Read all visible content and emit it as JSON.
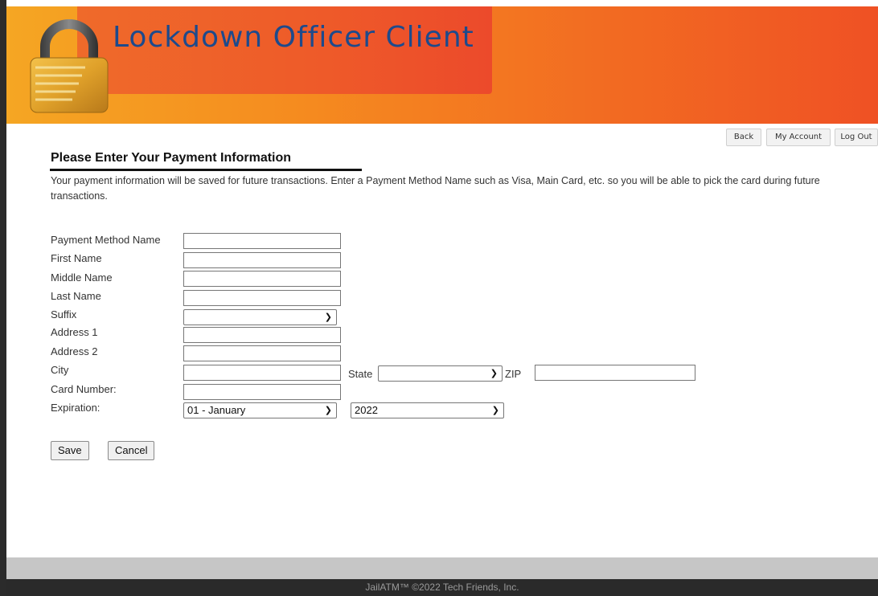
{
  "header": {
    "title": "Lockdown Officer Client",
    "logo_icon": "padlock-icon",
    "colors": {
      "banner_start": "#f5a623",
      "banner_end": "#ef5124",
      "title_color": "#1d4a8c"
    }
  },
  "nav": {
    "back": "Back",
    "my_account": "My Account",
    "log_out": "Log Out"
  },
  "page": {
    "title": "Please Enter Your Payment Information",
    "intro": "Your payment information will be saved for future transactions. Enter a Payment Method Name such as Visa, Main Card, etc. so you will be able to pick the card during future transactions."
  },
  "form": {
    "payment_method_name": {
      "label": "Payment Method Name",
      "value": ""
    },
    "first_name": {
      "label": "First Name",
      "value": ""
    },
    "middle_name": {
      "label": "Middle Name",
      "value": ""
    },
    "last_name": {
      "label": "Last Name",
      "value": ""
    },
    "suffix": {
      "label": "Suffix",
      "selected": ""
    },
    "address1": {
      "label": "Address 1",
      "value": ""
    },
    "address2": {
      "label": "Address 2",
      "value": ""
    },
    "city": {
      "label": "City",
      "value": ""
    },
    "state": {
      "label": "State",
      "selected": ""
    },
    "zip": {
      "label": "ZIP",
      "value": ""
    },
    "card_number": {
      "label": "Card Number:",
      "value": ""
    },
    "expiration": {
      "label": "Expiration:",
      "month": "01 - January",
      "year": "2022"
    }
  },
  "actions": {
    "save": "Save",
    "cancel": "Cancel"
  },
  "footer": {
    "text": "JailATM™ ©2022 Tech Friends, Inc."
  }
}
